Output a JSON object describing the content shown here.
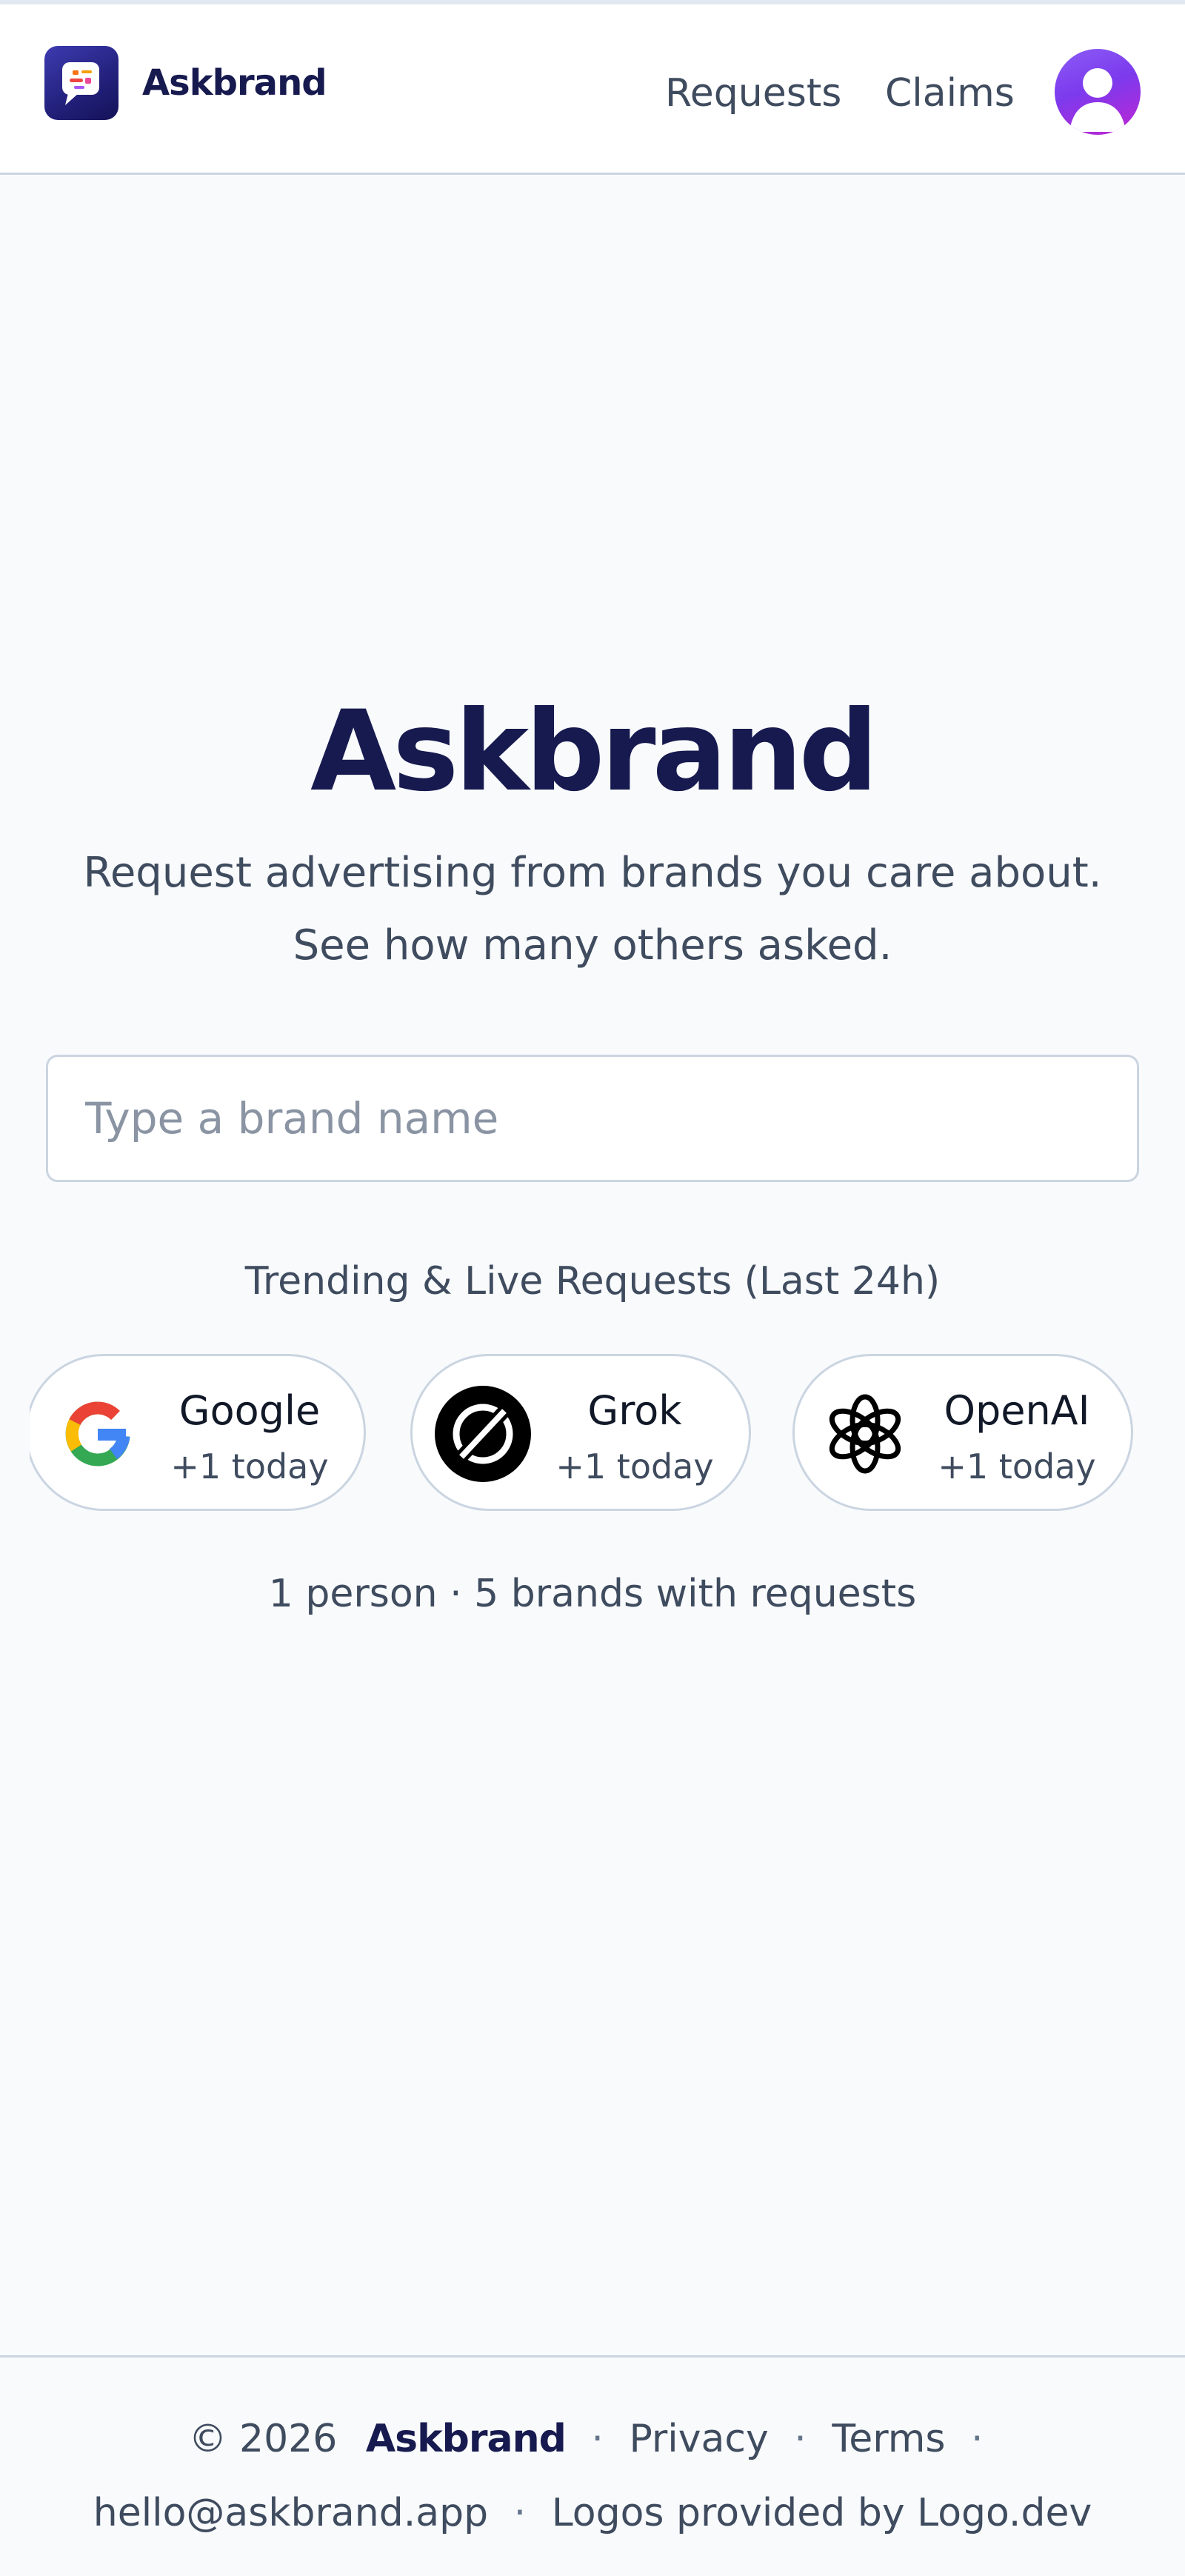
{
  "header": {
    "brand_name": "Askbrand",
    "nav": {
      "requests": "Requests",
      "claims": "Claims"
    }
  },
  "hero": {
    "title": "Askbrand",
    "tagline_line1": "Request advertising from brands you care about.",
    "tagline_line2": "See how many others asked."
  },
  "search": {
    "placeholder": "Type a brand name",
    "value": ""
  },
  "trending": {
    "title": "Trending & Live Requests (Last 24h)",
    "chips": [
      {
        "name": "Google",
        "count": "+1 today",
        "icon": "google-logo-icon"
      },
      {
        "name": "Grok",
        "count": "+1 today",
        "icon": "grok-logo-icon"
      },
      {
        "name": "OpenAI",
        "count": "+1 today",
        "icon": "openai-logo-icon"
      }
    ]
  },
  "stats": {
    "text": "1 person · 5 brands with requests"
  },
  "footer": {
    "copyright": "© 2026",
    "brand": "Askbrand",
    "privacy": "Privacy",
    "terms": "Terms",
    "email": "hello@askbrand.app",
    "logos_credit": "Logos provided by Logo.dev",
    "separator": "·"
  },
  "colors": {
    "brand_navy": "#171a4f",
    "text_slate": "#3f4b5e",
    "border": "#cbd5e1",
    "background": "#f8fafc",
    "avatar_purple": "#8b5cf6"
  }
}
